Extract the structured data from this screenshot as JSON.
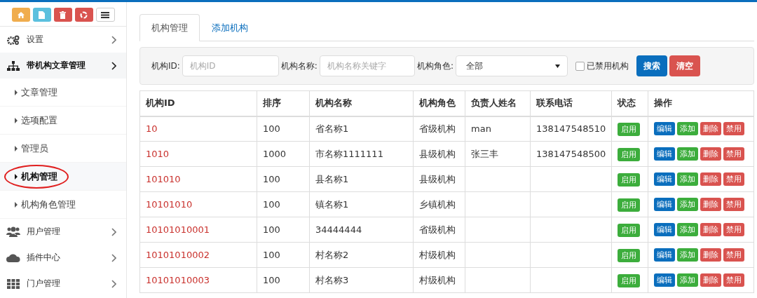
{
  "toolbar": [
    {
      "kind": "home"
    },
    {
      "kind": "file"
    },
    {
      "kind": "trash"
    },
    {
      "kind": "recycle"
    },
    {
      "kind": "list"
    }
  ],
  "menu": [
    {
      "label": "设置",
      "kind": "settings",
      "expanded": false
    },
    {
      "label": "带机构文章管理",
      "kind": "org",
      "expanded": true,
      "children": [
        {
          "label": "文章管理",
          "selected": false,
          "circled": false
        },
        {
          "label": "选项配置",
          "selected": false,
          "circled": false
        },
        {
          "label": "管理员",
          "selected": false,
          "circled": false
        },
        {
          "label": "机构管理",
          "selected": true,
          "circled": true
        },
        {
          "label": "机构角色管理",
          "selected": false,
          "circled": false
        }
      ]
    },
    {
      "label": "用户管理",
      "kind": "users",
      "expanded": false
    },
    {
      "label": "插件中心",
      "kind": "plugins",
      "expanded": false
    },
    {
      "label": "门户管理",
      "kind": "portal",
      "expanded": false
    }
  ],
  "tabs": [
    {
      "label": "机构管理",
      "selected": true
    },
    {
      "label": "添加机构",
      "selected": false
    }
  ],
  "filter": {
    "id_label": "机构ID:",
    "id_placeholder": "机构ID",
    "name_label": "机构名称:",
    "name_placeholder": "机构名称关键字",
    "role_label": "机构角色:",
    "role_value": "全部",
    "disabled_label": "已禁用机构",
    "disabled_checked": false,
    "buttons": [
      {
        "label": "搜索",
        "kind": "primary"
      },
      {
        "label": "清空",
        "kind": "danger"
      }
    ]
  },
  "table": {
    "columns": [
      "机构ID",
      "排序",
      "机构名称",
      "机构角色",
      "负责人姓名",
      "联系电话",
      "状态",
      "操作"
    ],
    "rows": [
      {
        "id": "10",
        "order": "100",
        "name": "省名称1",
        "role": "省级机构",
        "manager": "man",
        "phone": "138147548510",
        "status": "启用",
        "actions": [
          {
            "label": "编辑",
            "kind": "primary"
          },
          {
            "label": "添加",
            "kind": "success"
          },
          {
            "label": "删除",
            "kind": "danger"
          },
          {
            "label": "禁用",
            "kind": "danger"
          }
        ]
      },
      {
        "id": "1010",
        "order": "1000",
        "name": "市名称1111111",
        "role": "县级机构",
        "manager": "张三丰",
        "phone": "138147548500",
        "status": "启用",
        "actions": [
          {
            "label": "编辑",
            "kind": "primary"
          },
          {
            "label": "添加",
            "kind": "success"
          },
          {
            "label": "删除",
            "kind": "danger"
          },
          {
            "label": "禁用",
            "kind": "danger"
          }
        ]
      },
      {
        "id": "101010",
        "order": "100",
        "name": "县名称1",
        "role": "县级机构",
        "status": "启用",
        "actions": [
          {
            "label": "编辑",
            "kind": "primary"
          },
          {
            "label": "添加",
            "kind": "success"
          },
          {
            "label": "删除",
            "kind": "danger"
          },
          {
            "label": "禁用",
            "kind": "danger"
          }
        ]
      },
      {
        "id": "10101010",
        "order": "100",
        "name": "镇名称1",
        "role": "乡镇机构",
        "status": "启用",
        "actions": [
          {
            "label": "编辑",
            "kind": "primary"
          },
          {
            "label": "添加",
            "kind": "success"
          },
          {
            "label": "删除",
            "kind": "danger"
          },
          {
            "label": "禁用",
            "kind": "danger"
          }
        ]
      },
      {
        "id": "10101010001",
        "order": "100",
        "name": "34444444",
        "role": "省级机构",
        "status": "启用",
        "actions": [
          {
            "label": "编辑",
            "kind": "primary"
          },
          {
            "label": "添加",
            "kind": "success"
          },
          {
            "label": "删除",
            "kind": "danger"
          },
          {
            "label": "禁用",
            "kind": "danger"
          }
        ]
      },
      {
        "id": "10101010002",
        "order": "100",
        "name": "村名称2",
        "role": "村级机构",
        "status": "启用",
        "actions": [
          {
            "label": "编辑",
            "kind": "primary"
          },
          {
            "label": "添加",
            "kind": "success"
          },
          {
            "label": "删除",
            "kind": "danger"
          },
          {
            "label": "禁用",
            "kind": "danger"
          }
        ]
      },
      {
        "id": "10101010003",
        "order": "100",
        "name": "村名称3",
        "role": "村级机构",
        "status": "启用",
        "actions": [
          {
            "label": "编辑",
            "kind": "primary"
          },
          {
            "label": "添加",
            "kind": "success"
          },
          {
            "label": "删除",
            "kind": "danger"
          },
          {
            "label": "禁用",
            "kind": "danger"
          }
        ]
      }
    ]
  }
}
